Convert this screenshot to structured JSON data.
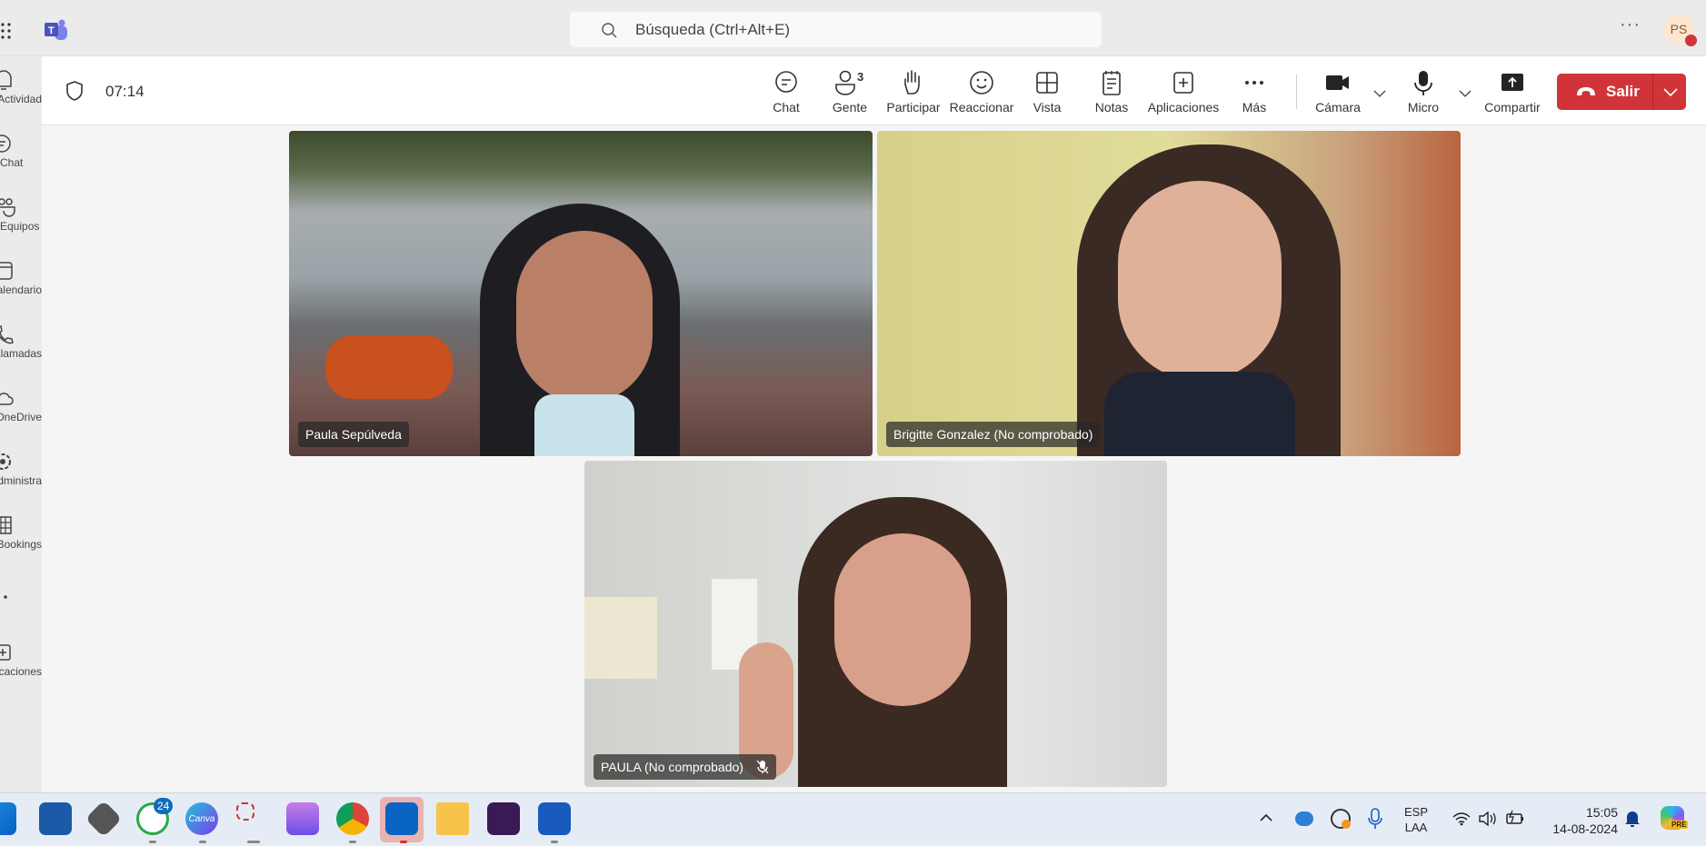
{
  "topbar": {
    "search_placeholder": "Búsqueda (Ctrl+Alt+E)",
    "avatar_initials": "PS",
    "more": "···"
  },
  "rail": {
    "items": [
      {
        "label": "Actividad",
        "icon": "bell-icon"
      },
      {
        "label": "Chat",
        "icon": "chat-icon"
      },
      {
        "label": "Equipos",
        "icon": "teams-icon"
      },
      {
        "label": "Calendario",
        "icon": "calendar-icon"
      },
      {
        "label": "Llamadas",
        "icon": "phone-icon"
      },
      {
        "label": "OneDrive",
        "icon": "cloud-icon"
      },
      {
        "label": "Administra...",
        "icon": "gear-icon"
      },
      {
        "label": "Bookings",
        "icon": "bookings-icon"
      },
      {
        "label": "",
        "icon": "more-icon"
      },
      {
        "label": "Aplicaciones",
        "icon": "add-apps-icon"
      }
    ]
  },
  "meeting": {
    "timer": "07:14",
    "people_count": "3",
    "toolbar": {
      "chat": "Chat",
      "people": "Gente",
      "raise": "Participar",
      "react": "Reaccionar",
      "view": "Vista",
      "notes": "Notas",
      "apps": "Aplicaciones",
      "more": "Más",
      "camera": "Cámara",
      "mic": "Micro",
      "share": "Compartir",
      "leave": "Salir"
    },
    "participants": [
      {
        "name": "Paula Sepúlveda",
        "muted": false
      },
      {
        "name": "Brigitte Gonzalez (No comprobado)",
        "muted": false
      },
      {
        "name": "PAULA (No comprobado)",
        "muted": true
      }
    ]
  },
  "colors": {
    "leave": "#d13438",
    "teams": "#5b5fc7"
  },
  "taskbar": {
    "whatsapp_badge": "24",
    "canva": "Canva",
    "lang": "ESP",
    "layout": "LAA",
    "time": "15:05",
    "date": "14-08-2024",
    "copilot_badge": "PRE"
  }
}
